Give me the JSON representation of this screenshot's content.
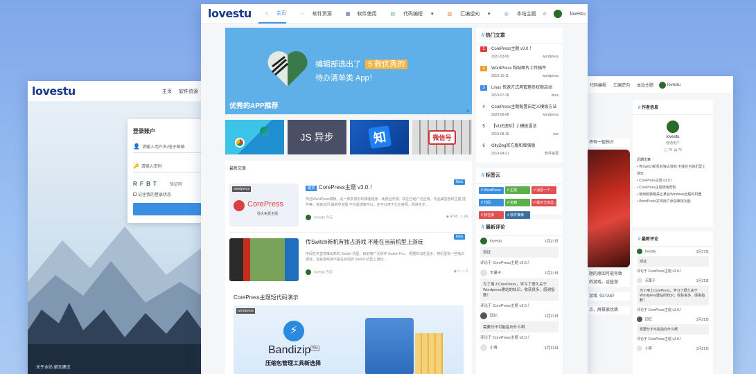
{
  "brand": "lovestu",
  "login_window": {
    "nav": [
      "主页",
      "软件资源"
    ],
    "title": "登录账户",
    "user_placeholder": "请输入用户名/电子邮箱",
    "pass_placeholder": "请输入密码",
    "captcha": "R F B T",
    "captcha_placeholder": "验证码",
    "remember": "记住我的登录状态",
    "login_btn": "登录",
    "footer": "关于本站  留言建议"
  },
  "main_window": {
    "nav": [
      "主页",
      "软件资源",
      "软件使用",
      "代码编程",
      "汇编逆向",
      "本站主题",
      "lovestu"
    ],
    "hero": {
      "line1": "编辑部选出了",
      "highlight": "5 款优秀的",
      "line2": "待办清单类 App！",
      "caption": "优秀的APP推荐"
    },
    "tiles": [
      "",
      "JS 异步",
      "知",
      "微信号"
    ],
    "latest_label": "最新文章",
    "posts": [
      {
        "tag": "置顶",
        "title": "CorePress主题 v3.0.！",
        "thumb_tag": "wordpress",
        "thumb_title": "CorePress",
        "thumb_sub": "强大免费主题",
        "excerpt": "简洁WordPress模板，是一款非常好的博客程序，免费且开源。现在已经广泛应用，作品兼容各种主题 插件等，快速访问 最新中文版 不仅是博客可以，还可以用于企业官网，阅读全文…",
        "author": "lovestu 今天",
        "views": "4765",
        "comments": "24",
        "badge": "New"
      },
      {
        "tag": "",
        "title": "传Switch新机有独占游戏 不能在当前机型上游玩",
        "thumb_tag": "",
        "thumb_title": "",
        "thumb_sub": "",
        "excerpt": "传闻任天堂将推出新的 Switch 机型，目前被广泛称作 Switch Pro。 根据的消息显示，将机型有一些独占游戏，这些游戏将不能在目前的 Switch 机型上游玩…",
        "author": "lovestu 今天",
        "views": "0",
        "comments": "0",
        "badge": "New"
      }
    ],
    "demo_title": "CorePress主题短代码演示",
    "demo": {
      "tag": "wordpress",
      "name": "Bandizip",
      "sup": "Win",
      "sub": "压缩包管理工具新选择"
    },
    "hot": {
      "title": "热门文章",
      "items": [
        {
          "n": "1",
          "t": "CorePress主题 v3.0.！",
          "d": "2021-03-06",
          "c": "wordpress"
        },
        {
          "n": "2",
          "t": "WordPress 粘贴图片上传插件",
          "d": "2019-10-11",
          "c": "wordpress"
        },
        {
          "n": "3",
          "t": "Linux 快速方式用管理员权限启动",
          "d": "2019-07-28",
          "c": "linux"
        },
        {
          "n": "4",
          "t": "CorePress主题配置自定义模板方法",
          "d": "2020-09-08",
          "c": "wordpress"
        },
        {
          "n": "5",
          "t": "【VUE进阶】2 模板语法",
          "d": "2019-08-15",
          "c": "vue"
        },
        {
          "n": "6",
          "t": "OllyDbg官方版和增强版",
          "d": "2019-04-21",
          "c": "软件资源"
        }
      ]
    },
    "tags_title": "标签云",
    "tags": [
      "# WordPress",
      "# 主题",
      "# 消息一个…",
      "# 代码",
      "# 宝箱",
      "# 提示分享此…",
      "# 我在家",
      "# 软件推荐",
      ""
    ],
    "comments_title": "最新评论",
    "comments": [
      {
        "name": "lovestu",
        "time": "1月27日",
        "text": "测试",
        "ref": "评论于 CorePress主题 v3.0.！"
      },
      {
        "name": "无量子",
        "time": "1月21日",
        "text": "为了用上CorePress，学习了很久关于Wordpress建站的知识，收获良多，感谢指教！",
        "ref": "评论于 CorePress主题 v3.0.！"
      },
      {
        "name": "回忆",
        "time": "1月21日",
        "text": "需要分不可能指向什么啊",
        "ref": "评论于 CorePress主题 v3.0.！"
      },
      {
        "name": "小蒋",
        "time": "1月21日",
        "text": "",
        "ref": ""
      }
    ]
  },
  "right_window": {
    "nav": [
      "代码编程",
      "汇编逆向",
      "本站主题",
      "lovestu"
    ],
    "author_title": "作者信息",
    "author_name": "lovestu",
    "author_role": "普通用户",
    "stats": [
      "79",
      "76"
    ],
    "recent_label": "近期文章",
    "recent": [
      "传Switch新机有独占游戏 不能在当前机型上游玩",
      "CorePress主题 v3.0.！",
      "CorePress主题使用帮助",
      "使用组策略禁止某台Windows远程的机器",
      "WordPress实现用户添加审核功能"
    ],
    "comments_title": "最新评论",
    "comments": [
      {
        "name": "lovestu",
        "time": "1月27日",
        "text": "测试",
        "ref": "评论于 CorePress主题 v3.0.！"
      },
      {
        "name": "无量子",
        "time": "1月21日",
        "text": "为了用上CorePress，学习了很久关于Wordpress建站的知识，收获良多，感谢指教！",
        "ref": "评论于 CorePress主题 v3.0.！"
      },
      {
        "name": "回忆",
        "time": "1月21日",
        "text": "需要分不可能指向什么啊",
        "ref": "评论于 CorePress主题 v3.0.！"
      },
      {
        "name": "小蒋",
        "time": "1月21日",
        "text": "",
        "ref": ""
      }
    ],
    "snippets": [
      "将有一些独占",
      "题的原因可能导致",
      "的游戏。这些游",
      "游戏《GTA5》",
      "点，屏幕很优质"
    ]
  },
  "colors": {
    "accent": "#3b8fe0",
    "hero_bg": "#5fb0e9",
    "brand": "#1a3a8a"
  }
}
